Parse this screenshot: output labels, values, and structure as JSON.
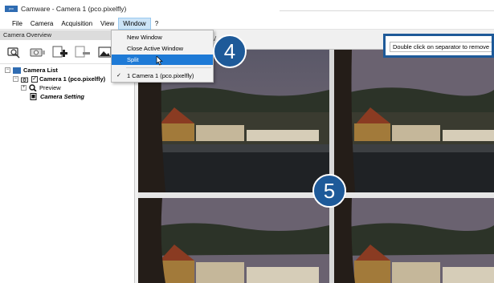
{
  "window": {
    "title": "Camware - Camera 1 (pco.pixelfly)",
    "app_icon": "camware-logo"
  },
  "menubar": {
    "items": [
      "File",
      "Camera",
      "Acquisition",
      "View",
      "Window",
      "?"
    ],
    "active": "Window"
  },
  "window_menu": {
    "items": [
      {
        "label": "New Window"
      },
      {
        "label": "Close Active Window"
      },
      {
        "label": "Split",
        "highlighted": true
      },
      {
        "label": "1 Camera 1 (pco.pixelfly)",
        "checked": true
      }
    ]
  },
  "camera_overview": {
    "header": "Camera Overview",
    "toolbar_icons": [
      "zoom-camera-icon",
      "camera-icon",
      "add-camera-icon",
      "remove-camera-icon",
      "image-icon"
    ],
    "tree": {
      "root": "Camera List",
      "camera": "Camera 1 (pco.pixelfly)",
      "preview": "Preview",
      "setting": "Camera Setting"
    }
  },
  "view_toolbar": {
    "partial_label": "V",
    "hint": "Double click on separator to remove"
  },
  "callouts": {
    "step_menu": "4",
    "step_split": "5"
  },
  "colors": {
    "accent": "#1e5a99",
    "menu_highlight": "#1e7ad6",
    "menu_active_bg": "#cce4f7"
  }
}
